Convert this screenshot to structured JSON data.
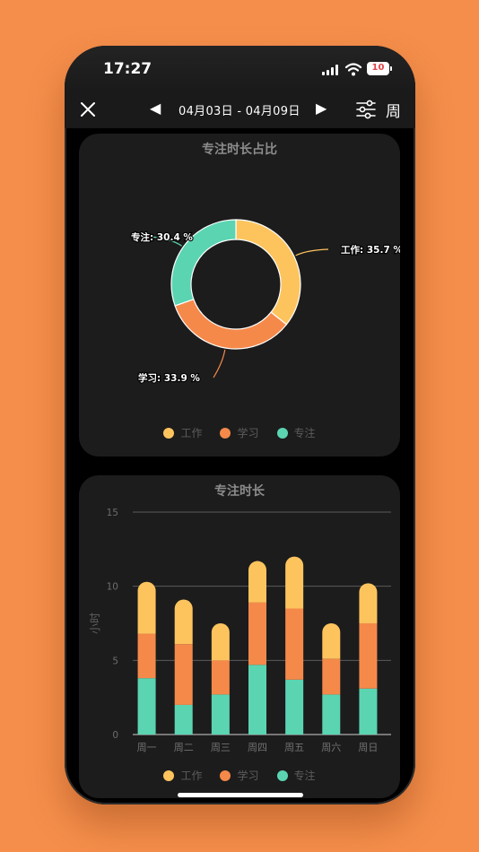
{
  "status": {
    "time": "17:27",
    "battery": "10"
  },
  "nav": {
    "date_range": "04月03日 - 04月09日",
    "period": "周"
  },
  "colors": {
    "work": "#FDC45E",
    "study": "#F5894A",
    "focus": "#5BD4B2",
    "background": "#F58E4B"
  },
  "icons": [
    "close-icon",
    "triangle-left-icon",
    "triangle-right-icon",
    "sliders-icon",
    "signal-icon",
    "wifi-icon",
    "battery-icon"
  ],
  "donut": {
    "title": "专注时长占比",
    "legend": [
      {
        "key": "work",
        "label": "工作"
      },
      {
        "key": "study",
        "label": "学习"
      },
      {
        "key": "focus",
        "label": "专注"
      }
    ]
  },
  "bars": {
    "title": "专注时长",
    "legend": [
      {
        "key": "work",
        "label": "工作"
      },
      {
        "key": "study",
        "label": "学习"
      },
      {
        "key": "focus",
        "label": "专注"
      }
    ]
  },
  "chart_data": [
    {
      "type": "pie",
      "title": "专注时长占比",
      "slices": [
        {
          "name": "工作",
          "value": 35.7,
          "label": "工作: 35.7 %"
        },
        {
          "name": "学习",
          "value": 33.9,
          "label": "学习: 33.9 %"
        },
        {
          "name": "专注",
          "value": 30.4,
          "label": "专注: 30.4 %"
        }
      ]
    },
    {
      "type": "bar",
      "stacked": true,
      "title": "专注时长",
      "ylabel": "小时",
      "ylim": [
        0,
        15
      ],
      "yticks": [
        "0",
        "5",
        "10",
        "15"
      ],
      "categories": [
        "周一",
        "周二",
        "周三",
        "周四",
        "周五",
        "周六",
        "周日"
      ],
      "series": [
        {
          "name": "专注",
          "values": [
            3.8,
            2.0,
            2.7,
            4.7,
            3.7,
            2.7,
            3.1
          ]
        },
        {
          "name": "学习",
          "values": [
            3.0,
            4.1,
            2.3,
            4.2,
            4.8,
            2.4,
            4.4
          ]
        },
        {
          "name": "工作",
          "values": [
            3.5,
            3.0,
            2.5,
            2.8,
            3.5,
            2.4,
            2.7
          ]
        }
      ]
    }
  ]
}
